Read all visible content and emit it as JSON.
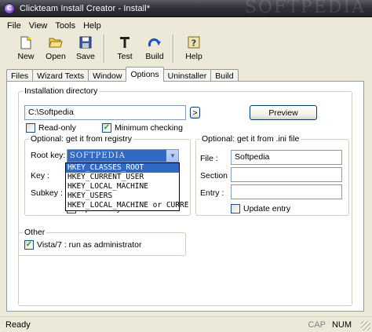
{
  "window": {
    "title": "Clickteam Install Creator - Install*"
  },
  "menu": [
    "File",
    "View",
    "Tools",
    "Help"
  ],
  "toolbar": {
    "new": "New",
    "open": "Open",
    "save": "Save",
    "test": "Test",
    "build": "Build",
    "help": "Help"
  },
  "tabs": [
    "Files",
    "Wizard Texts",
    "Window",
    "Options",
    "Uninstaller",
    "Build"
  ],
  "active_tab": "Options",
  "install_dir": {
    "legend": "Installation directory",
    "value": "C:\\Softpedia",
    "browse_label": ">",
    "preview_label": "Preview",
    "readonly_label": "Read-only",
    "readonly_checked": false,
    "min_check_label": "Minimum checking",
    "min_check_checked": true
  },
  "registry": {
    "legend": "Optional: get it from registry",
    "root_key_label": "Root key:",
    "key_label": "Key :",
    "subkey_label": "Subkey :",
    "update_key_label": "Update key",
    "update_key_checked": false,
    "options": [
      "HKEY_CLASSES_ROOT",
      "HKEY_CURRENT_USER",
      "HKEY_LOCAL_MACHINE",
      "HKEY_USERS",
      "HKEY_LOCAL_MACHINE or CURRE"
    ],
    "selected": "HKEY_CLASSES_ROOT"
  },
  "ini": {
    "legend": "Optional: get it from .ini file",
    "file_label": "File :",
    "file_value": "Softpedia",
    "section_label": "Section :",
    "section_value": "",
    "entry_label": "Entry :",
    "entry_value": "",
    "update_entry_label": "Update entry",
    "update_entry_checked": false
  },
  "other": {
    "legend": "Other",
    "vista_label": "Vista/7 : run as administrator",
    "vista_checked": true
  },
  "status": {
    "text": "Ready",
    "cap": "CAP",
    "num": "NUM"
  },
  "icons": {
    "new": "new-document-icon",
    "open": "open-folder-icon",
    "save": "save-disk-icon",
    "test": "test-T-icon",
    "build": "build-arrow-icon",
    "help": "help-question-icon"
  }
}
